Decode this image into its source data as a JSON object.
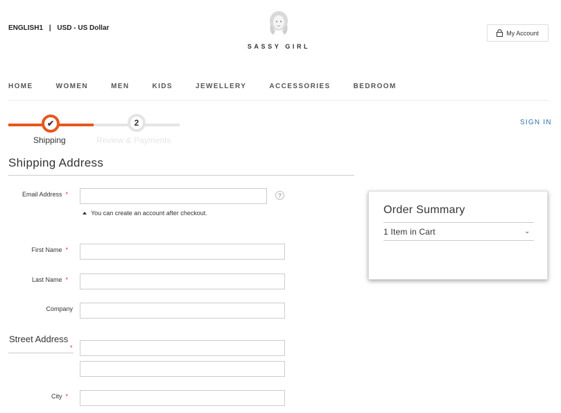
{
  "header": {
    "language": "ENGLISH1",
    "separator": "|",
    "currency": "USD - US Dollar",
    "logo_text": "SASSY GIRL",
    "account_label": "My Account"
  },
  "nav": {
    "items": [
      "HOME",
      "WOMEN",
      "MEN",
      "KIDS",
      "JEWELLERY",
      "ACCESSORIES",
      "BEDROOM"
    ]
  },
  "progress": {
    "steps": [
      {
        "label": "Shipping",
        "marker": "✔",
        "state": "complete"
      },
      {
        "label": "Review & Payments",
        "marker": "2",
        "state": "inactive"
      }
    ]
  },
  "sign_in": "SIGN IN",
  "form": {
    "title": "Shipping Address",
    "email": {
      "label": "Email Address",
      "required": "*",
      "value": ""
    },
    "help_icon": "?",
    "email_hint": "You can create an account after checkout.",
    "first_name": {
      "label": "First Name",
      "required": "*",
      "value": ""
    },
    "last_name": {
      "label": "Last Name",
      "required": "*",
      "value": ""
    },
    "company": {
      "label": "Company",
      "value": ""
    },
    "street": {
      "legend": "Street Address",
      "required": "*",
      "line1": "",
      "line2": ""
    },
    "city": {
      "label": "City",
      "required": "*",
      "value": ""
    }
  },
  "summary": {
    "title": "Order Summary",
    "cart_label": "1 Item in Cart",
    "chevron": "⌄"
  },
  "colors": {
    "accent": "#e8571d",
    "link": "#2d6fa8",
    "required": "#e02b27"
  }
}
